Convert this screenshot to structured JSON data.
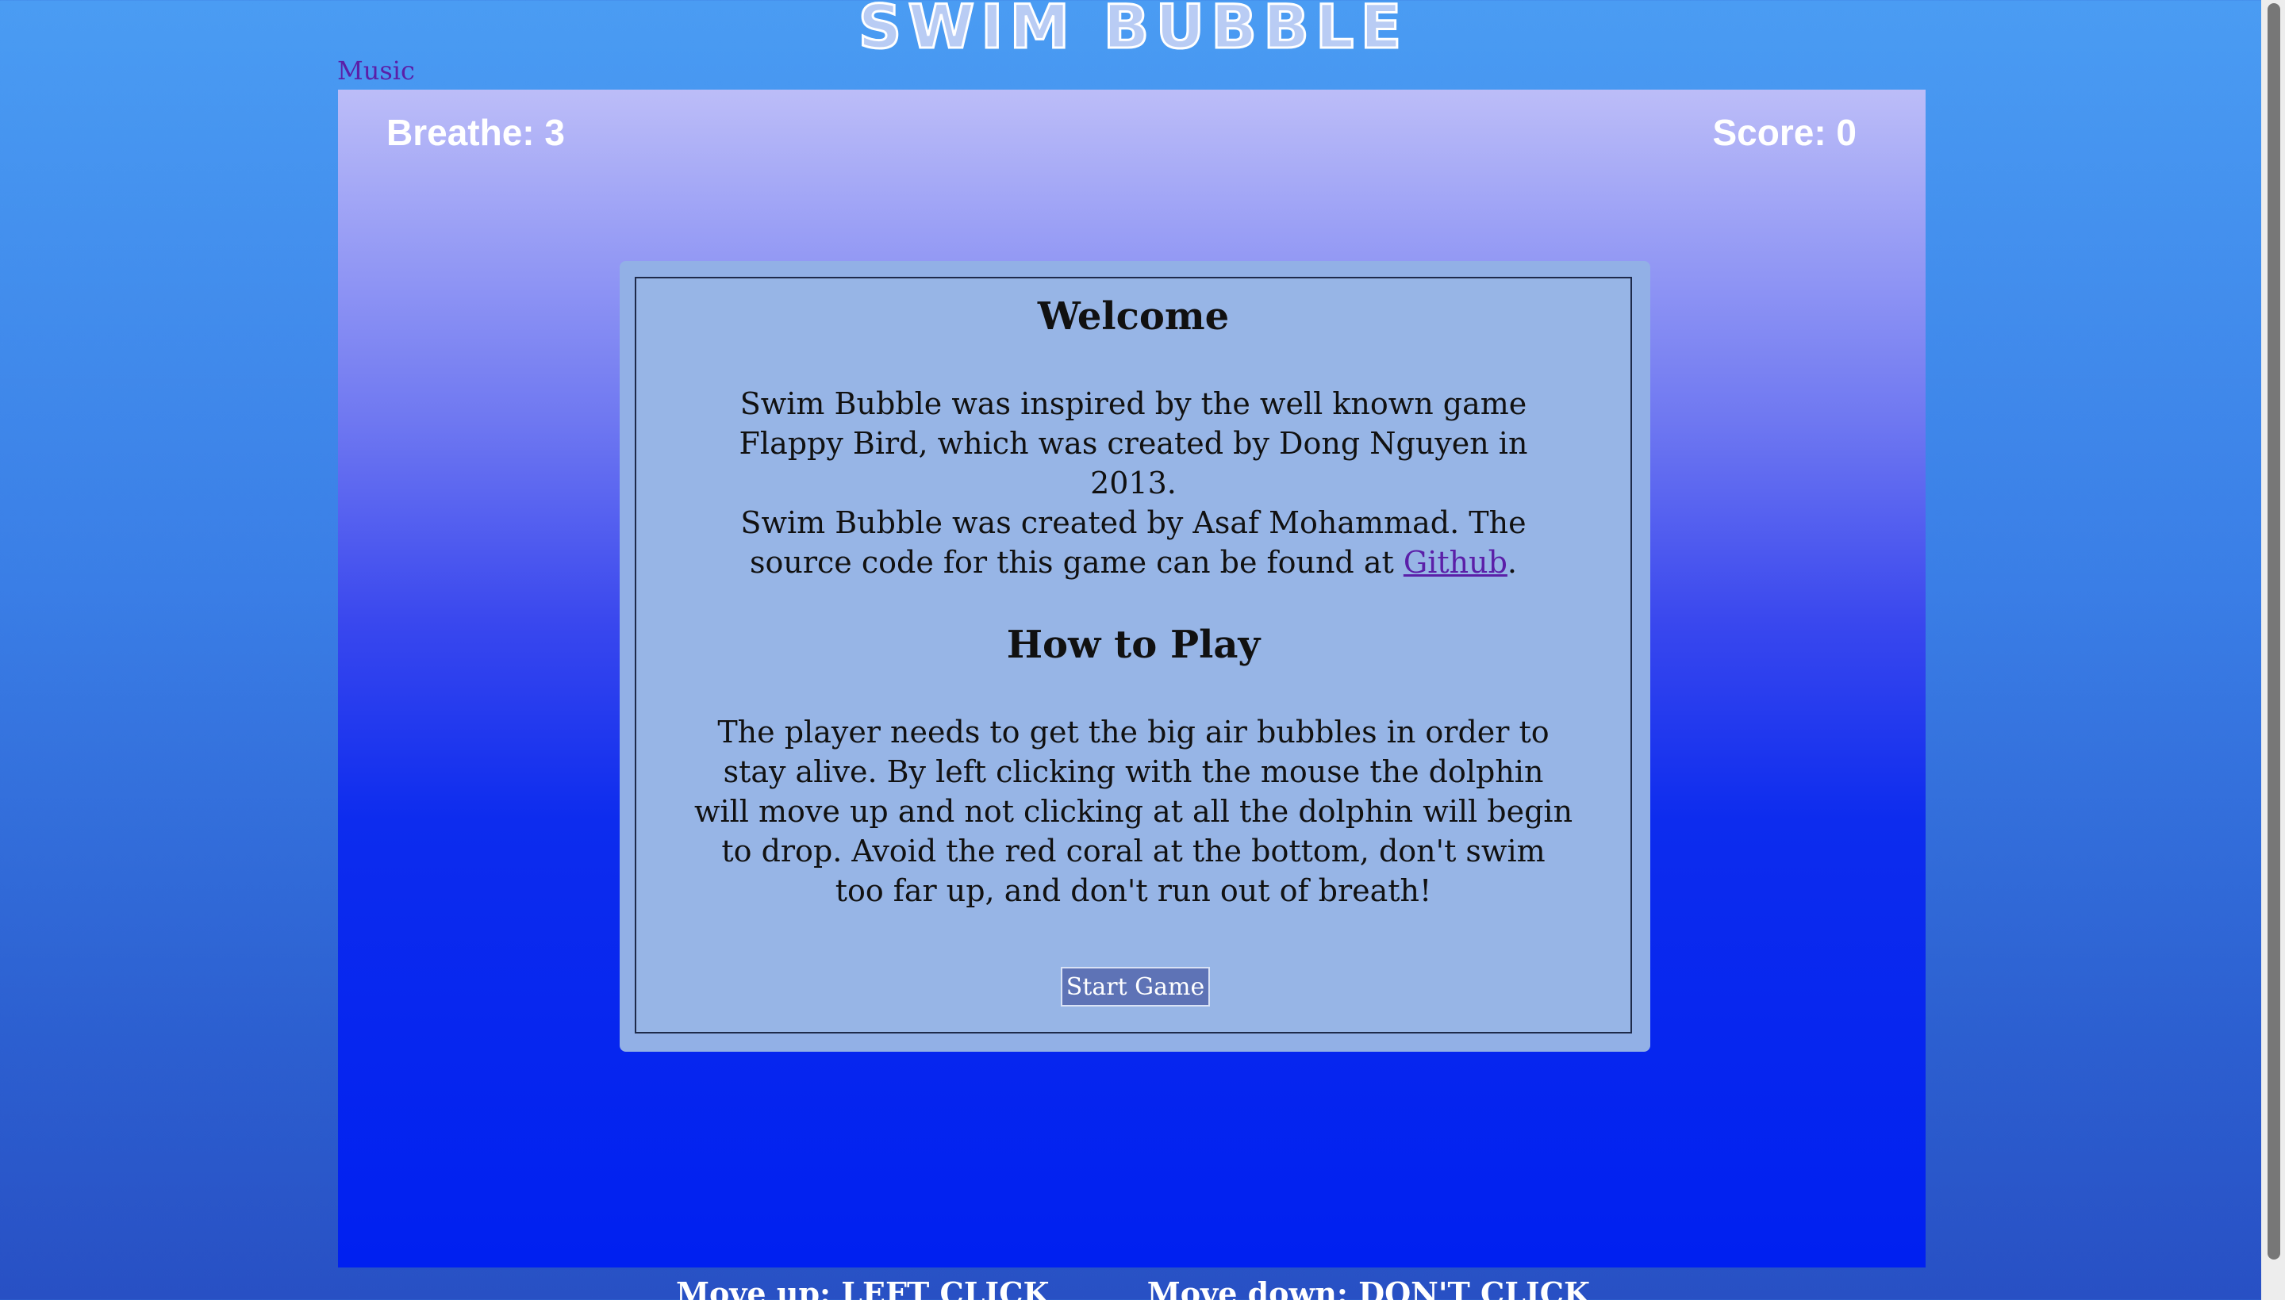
{
  "header": {
    "title": "SWIM BUBBLE",
    "music_label": "Music"
  },
  "hud": {
    "breathe": "Breathe: 3",
    "score": "Score: 0"
  },
  "panel": {
    "welcome_heading": "Welcome",
    "intro_text": "Swim Bubble was inspired by the well known game Flappy Bird, which was created by Dong Nguyen in 2013.",
    "credit_text_before": "Swim Bubble was created by Asaf Mohammad. The source code for this game can be found at ",
    "credit_link": "Github",
    "credit_text_after": ".",
    "howto_heading": "How to Play",
    "howto_text": "The player needs to get the big air bubbles in order to stay alive. By left clicking with the mouse the dolphin will move up and not clicking at all the dolphin will begin to drop. Avoid the red coral at the bottom, don't swim too far up, and don't run out of breath!",
    "start_button": "Start Game"
  },
  "controls": {
    "move_up": "Move up: LEFT CLICK",
    "move_down": "Move down: DON'T CLICK"
  },
  "colors": {
    "background": "#4a9cf3",
    "game_top": "#bcbdf8",
    "game_bottom": "#0020f0",
    "panel": "#97b5e6",
    "link": "#5b1fa8",
    "button": "#5e73b6"
  }
}
